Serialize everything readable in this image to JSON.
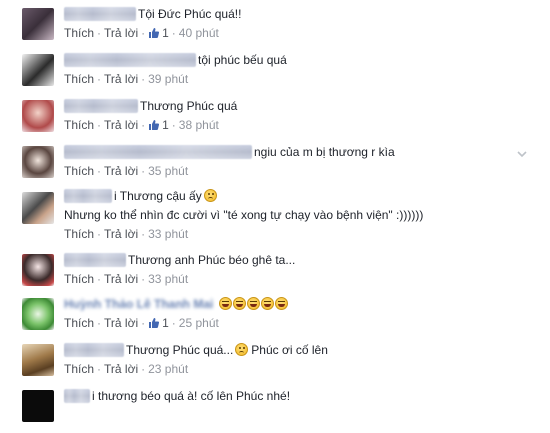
{
  "actions": {
    "like": "Thích",
    "reply": "Trả lời",
    "separator": "·"
  },
  "colors": {
    "link": "#4b4f56",
    "meta": "#90949c",
    "text": "#1d2129",
    "like_blue": "#4267b2"
  },
  "comments": [
    {
      "text": "Tội Đức Phúc quá!!",
      "likes": "1",
      "time": "40 phút",
      "has_likes": true
    },
    {
      "text": "tội phúc bếu quá",
      "likes": "",
      "time": "39 phút",
      "has_likes": false
    },
    {
      "text": "Thương Phúc quá",
      "likes": "1",
      "time": "38 phút",
      "has_likes": true
    },
    {
      "text": "ngiu của m bị thương r kìa",
      "likes": "",
      "time": "35 phút",
      "has_likes": false
    },
    {
      "text": "i Thương cậu ấy",
      "text2": "Nhưng ko thể nhìn đc cười vì \"té xong tự chạy vào bệnh viện\" :))))))",
      "likes": "",
      "time": "33 phút",
      "has_likes": false
    },
    {
      "text": "Thương anh Phúc béo ghê ta...",
      "likes": "",
      "time": "33 phút",
      "has_likes": false
    },
    {
      "author": "Huỳnh Thảo Lê Thanh Mai",
      "likes": "1",
      "time": "25 phút",
      "has_likes": true
    },
    {
      "text": "Thương Phúc quá...",
      "text_after": "Phúc ơi cố lên",
      "likes": "",
      "time": "23 phút",
      "has_likes": false
    },
    {
      "text": "i thương béo quá à! cố lên Phúc nhé!",
      "likes": "",
      "time": "",
      "has_likes": false
    }
  ],
  "icons": {
    "like_badge": "thumbs-up-icon",
    "chevron": "chevron-down-icon",
    "emoji_frown": "frown-emoji-icon",
    "emoji_laugh": "laughing-emoji-icon"
  }
}
